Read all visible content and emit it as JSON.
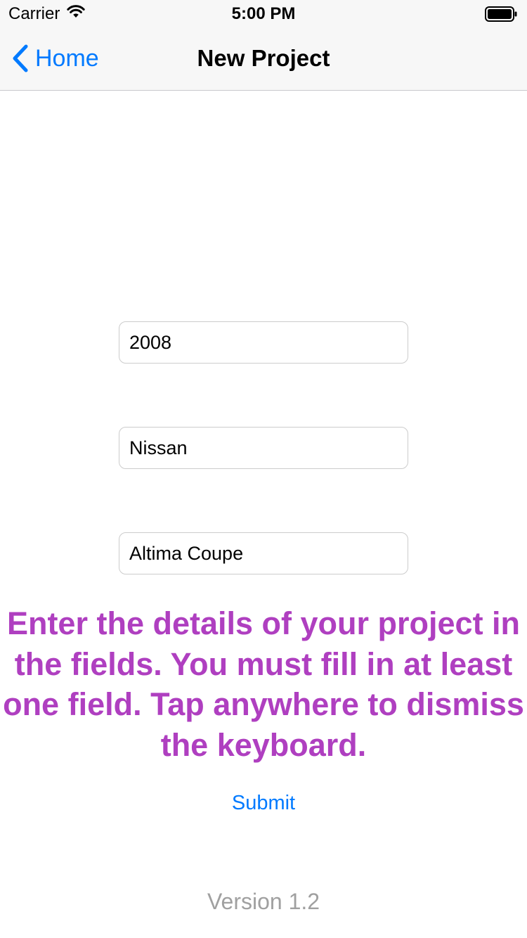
{
  "status_bar": {
    "carrier": "Carrier",
    "time": "5:00 PM"
  },
  "nav": {
    "back_label": "Home",
    "title": "New Project"
  },
  "form": {
    "fields": [
      {
        "value": "2008"
      },
      {
        "value": "Nissan"
      },
      {
        "value": "Altima Coupe"
      }
    ],
    "instructions": "Enter the details of your project in the fields. You must fill in at least one field. Tap anywhere to dismiss the keyboard.",
    "submit_label": "Submit"
  },
  "footer": {
    "version": "Version 1.2"
  },
  "colors": {
    "accent": "#007aff",
    "instructions": "#af3fc0",
    "version_text": "#a0a0a0"
  },
  "icons": {
    "back": "chevron-left-icon",
    "wifi": "wifi-icon",
    "battery": "battery-icon"
  }
}
